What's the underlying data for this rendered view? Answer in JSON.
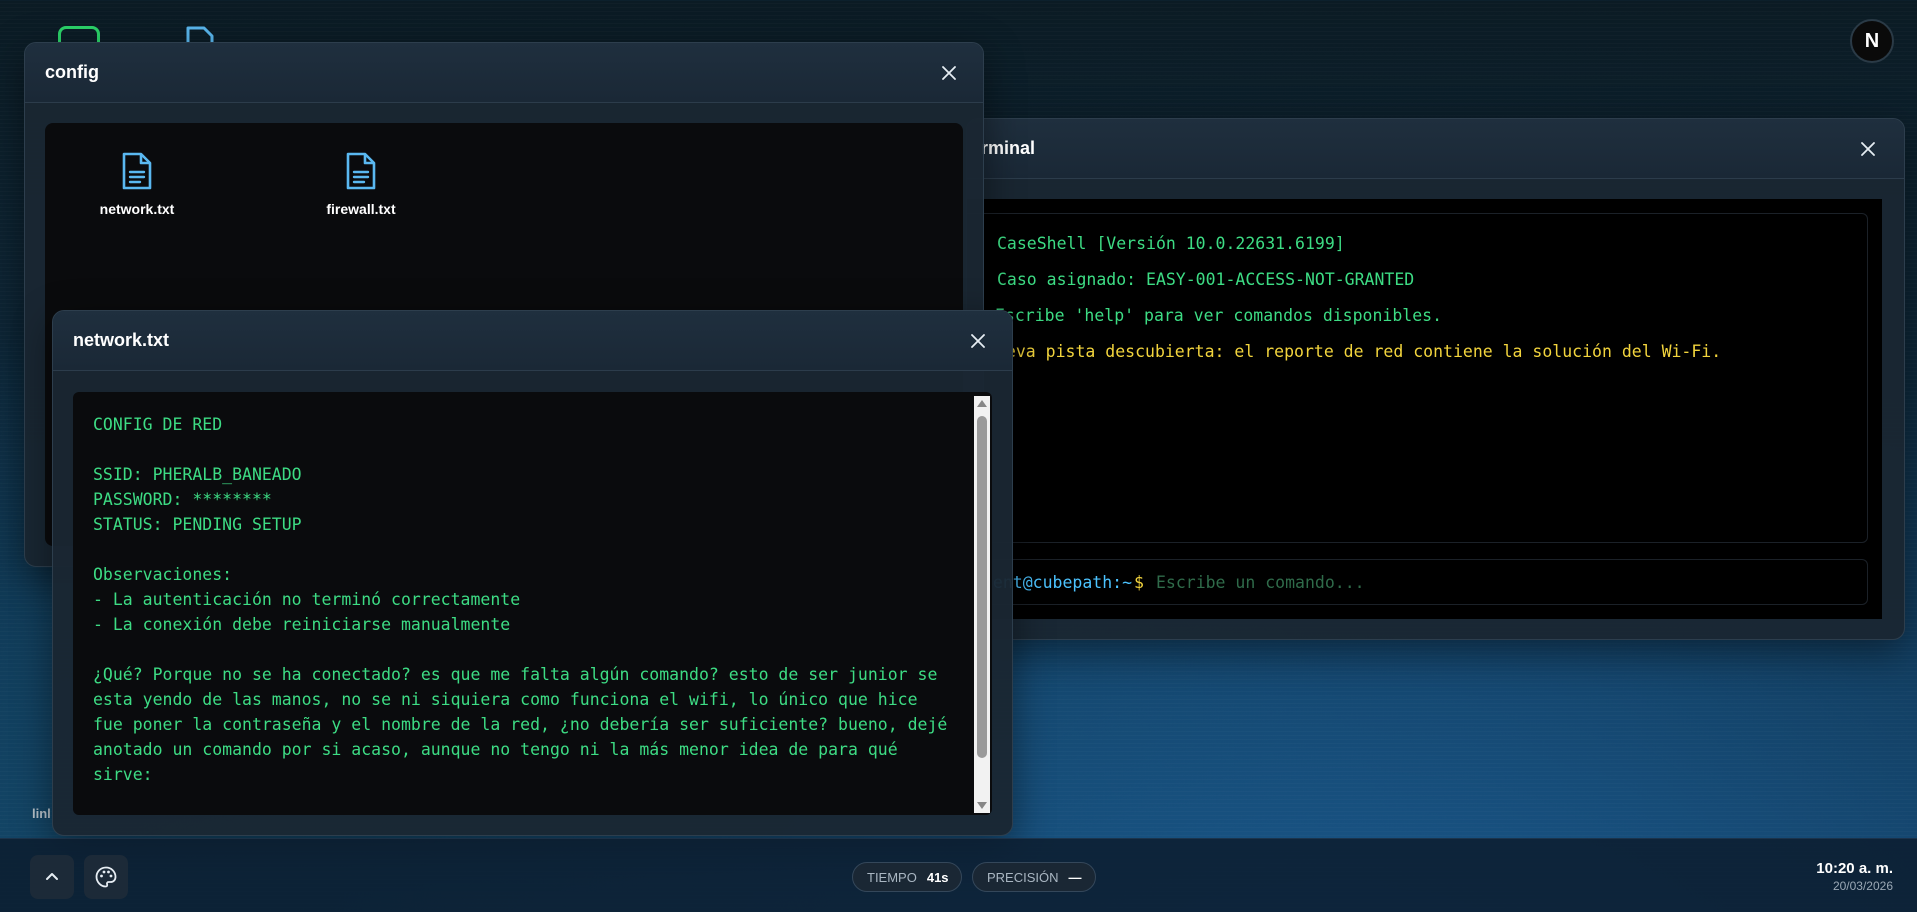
{
  "desktop": {
    "avatar_letter": "N",
    "partial_label": "linl"
  },
  "terminal_window": {
    "title": "rminal",
    "lines": [
      {
        "text": "CaseShell [Versión 10.0.22631.6199]",
        "color": "green"
      },
      {
        "text": "Caso asignado: EASY-001-ACCESS-NOT-GRANTED",
        "color": "green"
      },
      {
        "text": "Escribe 'help' para ver comandos disponibles.",
        "color": "green"
      },
      {
        "text": "ueva pista descubierta: el reporte de red contiene la solución del Wi-Fi.",
        "color": "yellow"
      }
    ],
    "prompt_user": "gent@cubepath:~",
    "prompt_symbol": "$",
    "input_placeholder": "Escribe un comando...",
    "input_value": ""
  },
  "config_window": {
    "title": "config",
    "files": [
      {
        "name": "network.txt"
      },
      {
        "name": "firewall.txt"
      }
    ]
  },
  "network_window": {
    "title": "network.txt",
    "content": "CONFIG DE RED\n\nSSID: PHERALB_BANEADO\nPASSWORD: ********\nSTATUS: PENDING SETUP\n\nObservaciones:\n- La autenticación no terminó correctamente\n- La conexión debe reiniciarse manualmente\n\n¿Qué? Porque no se ha conectado? es que me falta algún comando? esto de ser junior se esta yendo de las manos, no se ni siquiera como funciona el wifi, lo único que hice fue poner la contraseña y el nombre de la red, ¿no debería ser suficiente? bueno, dejé anotado un comando por si acaso, aunque no tengo ni la más menor idea de para qué sirve:"
  },
  "taskbar": {
    "time_label": "TIEMPO",
    "time_value": "41s",
    "precision_label": "PRECISIÓN",
    "precision_value": "—",
    "clock_time": "10:20 a. m.",
    "clock_date": "20/03/2026"
  },
  "colors": {
    "terminal_green": "#3ddc84",
    "terminal_yellow": "#f2d43d",
    "prompt_blue": "#4cc3ff",
    "file_icon_blue": "#5ab8f0"
  }
}
